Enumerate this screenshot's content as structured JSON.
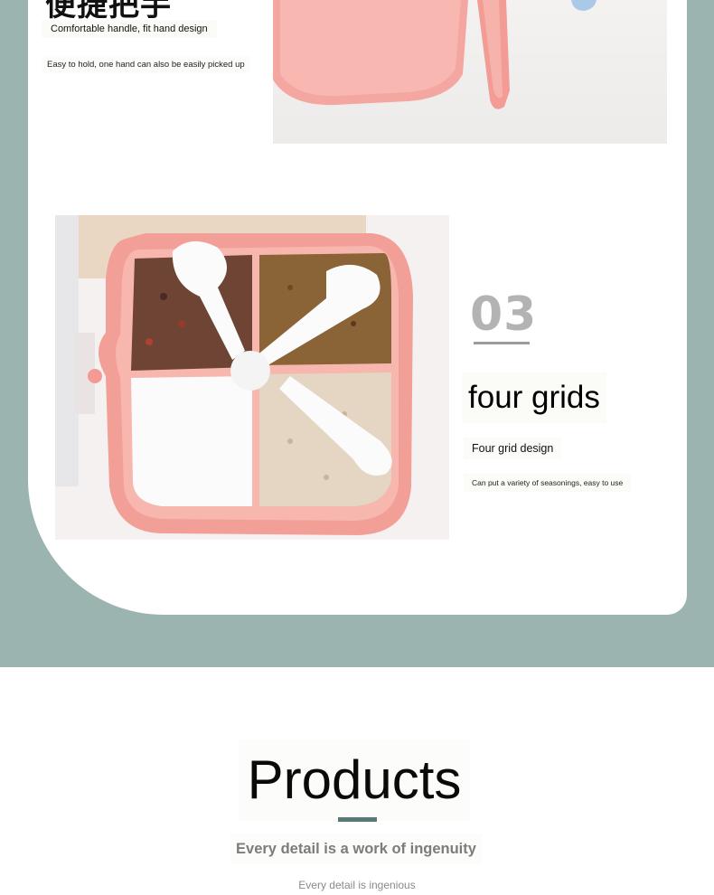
{
  "feature_handle": {
    "heading": "便捷把手",
    "title": "Comfortable handle, fit hand design",
    "description": "Easy to hold, one hand can also be easily picked up"
  },
  "feature_grids": {
    "number": "03",
    "heading": "four grids",
    "title": "Four grid design",
    "description": "Can put a variety of seasonings, easy to use"
  },
  "products": {
    "title": "Products",
    "subtitle": "Every detail is a work of ingenuity",
    "caption": "Every detail is ingenious"
  },
  "colors": {
    "teal_background": "#9bb4b0",
    "accent_bar": "#567b77",
    "product_pink": "#f3a59e",
    "number_gray": "#b3b3b3"
  }
}
